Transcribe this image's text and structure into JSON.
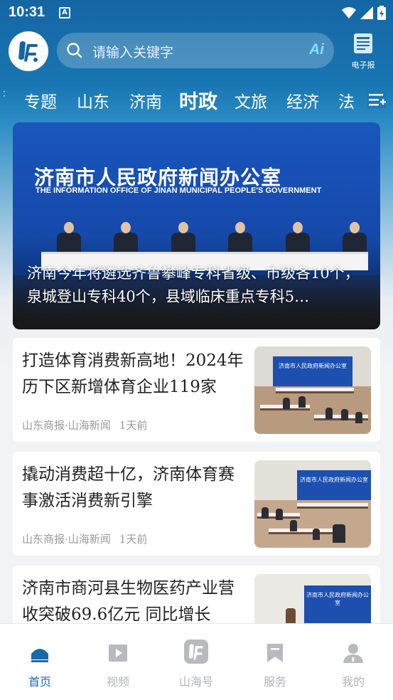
{
  "status_bar": {
    "time": "10:31",
    "sim_icon": "A"
  },
  "header": {
    "logo_icon": "shanhai-logo-icon",
    "search_placeholder": "请输入关键字",
    "ai_label": "Ai",
    "epaper_label": "电子报"
  },
  "tabs": {
    "items": [
      {
        "label": "专题"
      },
      {
        "label": "山东"
      },
      {
        "label": "济南"
      },
      {
        "label": "时政"
      },
      {
        "label": "文旅"
      },
      {
        "label": "经济"
      },
      {
        "label": "法"
      }
    ],
    "active_index": 3
  },
  "hero": {
    "org_cn": "济南市人民政府新闻办公室",
    "org_en": "THE INFORMATION OFFICE OF JINAN MUNICIPAL PEOPLE'S GOVERNMENT",
    "title": "济南今年将遴选齐鲁攀峰专科省级、市级各10个，泉城登山专科40个，县域临床重点专科5…"
  },
  "news": [
    {
      "title": "打造体育消费新高地！2024年历下区新增体育企业119家",
      "source": "山东商报·山海新闻",
      "time": "1天前",
      "thumb_banner": "济南市人民政府新闻办公室"
    },
    {
      "title": "撬动消费超十亿，济南体育赛事激活消费新引擎",
      "source": "山东商报·山海新闻",
      "time": "1天前",
      "thumb_banner": "济南市人民政府新闻办公室"
    },
    {
      "title": "济南市商河县生物医药产业营收突破69.6亿元 同比增长",
      "source": "",
      "time": "",
      "thumb_banner": "济南市人民政府新闻办公室"
    }
  ],
  "bottom_nav": {
    "items": [
      {
        "label": "首页",
        "icon": "home-icon"
      },
      {
        "label": "视频",
        "icon": "video-icon"
      },
      {
        "label": "山海号",
        "icon": "shanhai-icon"
      },
      {
        "label": "服务",
        "icon": "bookmark-icon"
      },
      {
        "label": "我的",
        "icon": "profile-icon"
      }
    ],
    "active_index": 0
  },
  "colors": {
    "brand": "#1b6aa8",
    "header_bg": "#1466a3",
    "inactive": "#b0b3b8"
  }
}
